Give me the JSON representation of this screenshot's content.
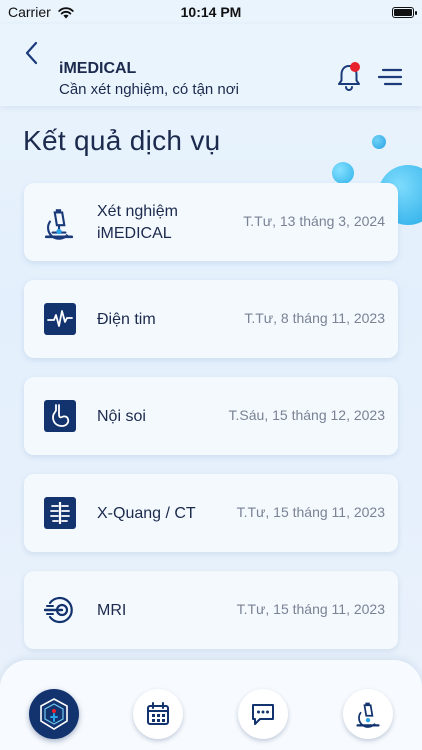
{
  "status_bar": {
    "carrier": "Carrier",
    "time": "10:14 PM"
  },
  "header": {
    "title": "iMEDICAL",
    "subtitle": "Cần xét nghiệm, có tận nơi",
    "has_notification": true
  },
  "page": {
    "title": "Kết quả dịch vụ"
  },
  "services": [
    {
      "name_line1": "Xét nghiệm",
      "name_line2": "iMEDICAL",
      "date": "T.Tư, 13 tháng 3, 2024",
      "icon": "microscope-icon"
    },
    {
      "name_line1": "Điện tim",
      "name_line2": "",
      "date": "T.Tư, 8 tháng 11, 2023",
      "icon": "ecg-icon"
    },
    {
      "name_line1": "Nội soi",
      "name_line2": "",
      "date": "T.Sáu, 15 tháng 12, 2023",
      "icon": "stomach-icon"
    },
    {
      "name_line1": "X-Quang / CT",
      "name_line2": "",
      "date": "T.Tư, 15 tháng 11, 2023",
      "icon": "xray-icon"
    },
    {
      "name_line1": "MRI",
      "name_line2": "",
      "date": "T.Tư, 15 tháng 11, 2023",
      "icon": "mri-icon"
    }
  ],
  "bottom_nav": [
    {
      "name": "home-logo-icon"
    },
    {
      "name": "calendar-icon"
    },
    {
      "name": "chat-icon"
    },
    {
      "name": "microscope-icon"
    }
  ],
  "colors": {
    "primary": "#13336f",
    "accent": "#2aa3e6",
    "notification": "#e8202e",
    "text": "#1b2a4d",
    "date_text": "#7a8294"
  }
}
